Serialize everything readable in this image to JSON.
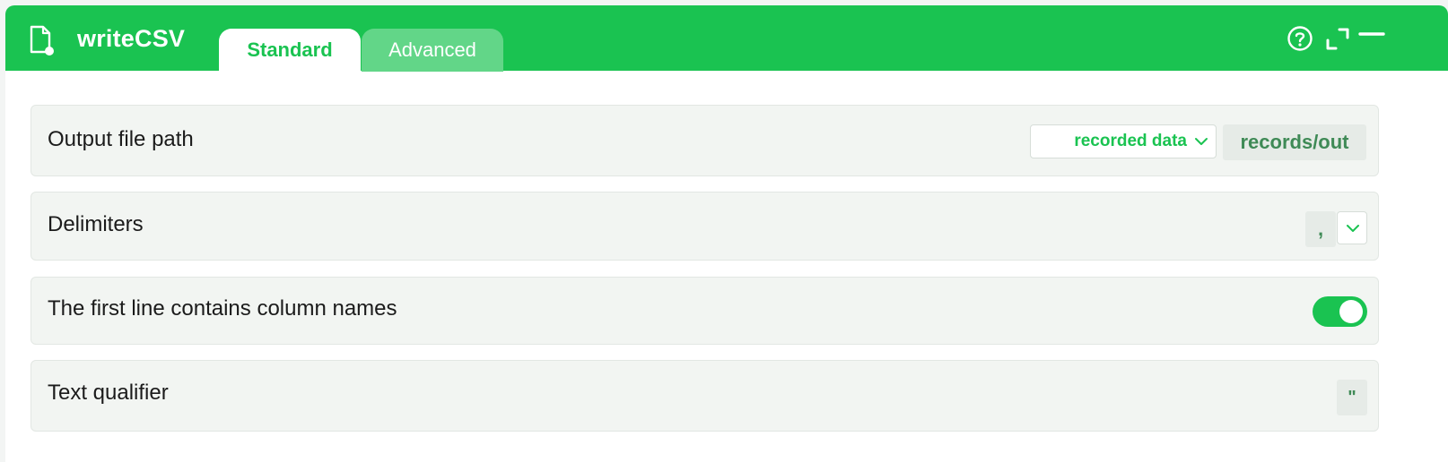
{
  "header": {
    "title": "writeCSV",
    "tabs": [
      {
        "label": "Standard",
        "active": true
      },
      {
        "label": "Advanced",
        "active": false
      }
    ],
    "icons": [
      "file-icon",
      "help-icon",
      "expand-icon",
      "minimize-icon"
    ]
  },
  "colors": {
    "accent": "#1ac351",
    "accent_light": "#62d688",
    "value_text": "#3f8a56",
    "row_background": "#f2f5f2"
  },
  "fields": {
    "output_path": {
      "label": "Output file path",
      "source": "recorded data",
      "value": "records/out"
    },
    "delimiters": {
      "label": "Delimiters",
      "value": ","
    },
    "header_row": {
      "label": "The first line contains column names",
      "enabled": true
    },
    "text_qualifier": {
      "label": "Text qualifier",
      "value": "\""
    }
  }
}
